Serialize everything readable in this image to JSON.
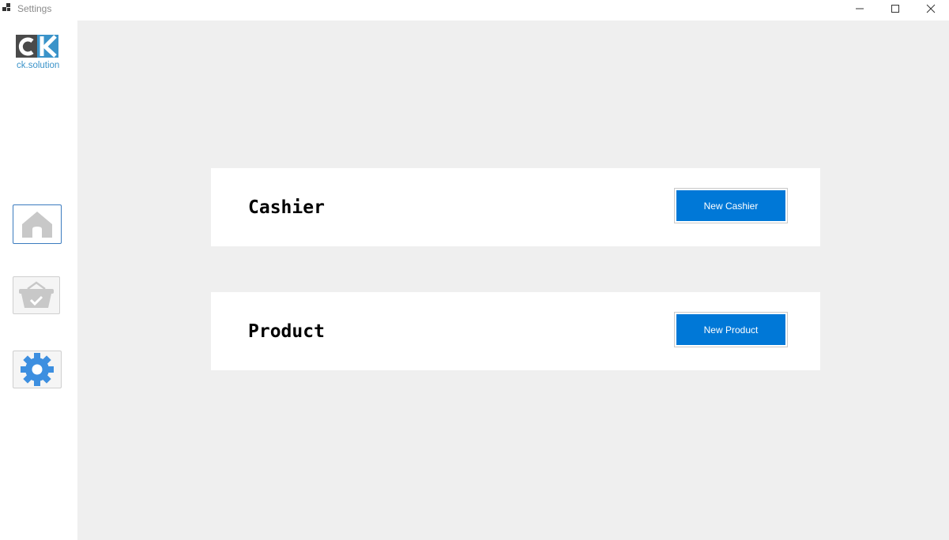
{
  "window": {
    "title": "Settings"
  },
  "brand": {
    "logo_letters": "CK",
    "name": "ck.solution",
    "accent": "#3a93c9"
  },
  "sidebar": {
    "items": [
      {
        "id": "home",
        "icon": "home-icon",
        "active": true
      },
      {
        "id": "basket",
        "icon": "basket-check-icon",
        "active": false
      },
      {
        "id": "settings",
        "icon": "gear-icon",
        "active": false
      }
    ]
  },
  "sections": [
    {
      "title": "Cashier",
      "button_label": "New Cashier"
    },
    {
      "title": "Product",
      "button_label": "New Product"
    }
  ],
  "colors": {
    "primary_button": "#0078d7",
    "main_background": "#efefef",
    "gear": "#3d8fe0",
    "icon_gray": "#c8c8c8"
  }
}
